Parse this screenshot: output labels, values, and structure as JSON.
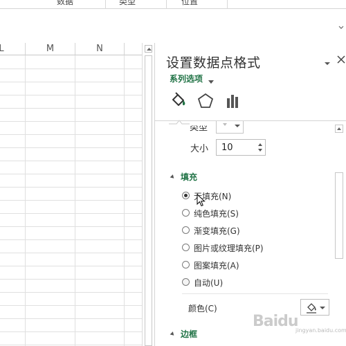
{
  "ribbon": {
    "tabs": [
      "数据",
      "类型",
      "位置"
    ]
  },
  "sheet": {
    "columns": [
      "L",
      "M",
      "N"
    ]
  },
  "panel": {
    "title": "设置数据点格式",
    "series_options_label": "系列选项",
    "tabs": [
      {
        "name": "fill-line",
        "icon": "paint-bucket-icon"
      },
      {
        "name": "effects",
        "icon": "pentagon-icon"
      },
      {
        "name": "series-options",
        "icon": "bar-chart-icon"
      }
    ],
    "marker": {
      "type_label": "类型",
      "size_label": "大小",
      "size_value": "10"
    },
    "fill_section": {
      "heading": "填充",
      "options": [
        {
          "label": "无填充(N)",
          "checked": true
        },
        {
          "label": "纯色填充(S)",
          "checked": false
        },
        {
          "label": "渐变填充(G)",
          "checked": false
        },
        {
          "label": "图片或纹理填充(P)",
          "checked": false
        },
        {
          "label": "图案填充(A)",
          "checked": false
        },
        {
          "label": "自动(U)",
          "checked": false
        }
      ],
      "color_label": "颜色(C)"
    },
    "border_section": {
      "heading": "边框"
    }
  },
  "watermark": {
    "text": "Baidu",
    "sub": "jingyan.baidu.com"
  },
  "colors": {
    "accent_green": "#217346"
  }
}
